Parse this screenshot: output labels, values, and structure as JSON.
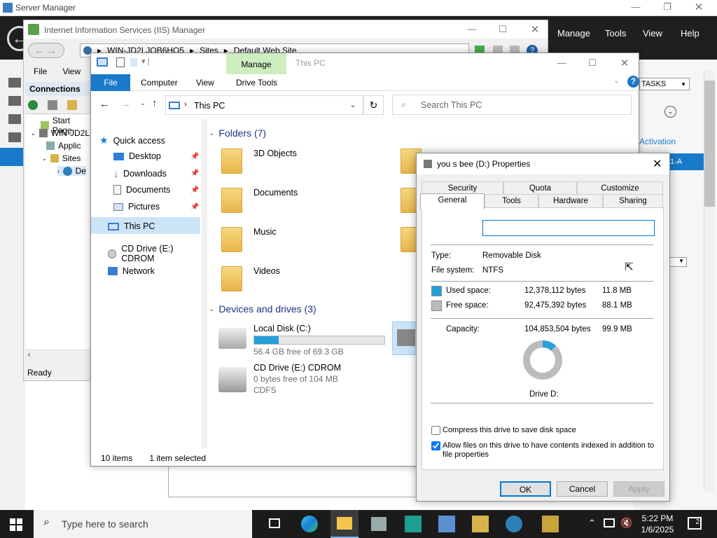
{
  "server_manager": {
    "title": "Server Manager",
    "nav": [
      "Manage",
      "Tools",
      "View",
      "Help"
    ],
    "tasks_label": "TASKS",
    "activation_link": "Activation",
    "partial_label": "1-A"
  },
  "iis": {
    "title": "Internet Information Services (IIS) Manager",
    "breadcrumb": [
      "WIN-JD2LJQB6HO5",
      "Sites",
      "Default Web Site"
    ],
    "menu": [
      "File",
      "View"
    ],
    "connections_label": "Connections",
    "tree": [
      "Start Page",
      "WIN-JD2L",
      "Applic",
      "Sites",
      "De"
    ],
    "status": "Ready"
  },
  "explorer": {
    "title": "This PC",
    "ribbon_tabs": [
      "File",
      "Computer",
      "View"
    ],
    "manage_label": "Manage",
    "drive_tools": "Drive Tools",
    "address": "This PC",
    "search_placeholder": "Search This PC",
    "nav": {
      "quick_access": "Quick access",
      "desktop": "Desktop",
      "downloads": "Downloads",
      "documents": "Documents",
      "pictures": "Pictures",
      "this_pc": "This PC",
      "cd_drive": "CD Drive (E:) CDROM",
      "network": "Network"
    },
    "folders_header": "Folders (7)",
    "folders": [
      "3D Objects",
      "Documents",
      "Music",
      "Videos"
    ],
    "devices_header": "Devices and drives (3)",
    "drives": [
      {
        "name": "Local Disk (C:)",
        "free": "56.4 GB free of 69.3 GB",
        "used_pct": 19
      },
      {
        "name": "CD Drive (E:) CDROM",
        "free": "0 bytes free of 104 MB",
        "fs": "CDFS"
      }
    ],
    "status_items": "10 items",
    "status_selected": "1 item selected"
  },
  "properties": {
    "title": "you s bee (D:) Properties",
    "tabs_row1": [
      "Security",
      "Quota",
      "Customize"
    ],
    "tabs_row2": [
      "General",
      "Tools",
      "Hardware",
      "Sharing"
    ],
    "name_value": "",
    "type_label": "Type:",
    "type_value": "Removable Disk",
    "fs_label": "File system:",
    "fs_value": "NTFS",
    "used_label": "Used space:",
    "used_bytes": "12,378,112 bytes",
    "used_mb": "11.8 MB",
    "free_label": "Free space:",
    "free_bytes": "92,475,392 bytes",
    "free_mb": "88.1 MB",
    "cap_label": "Capacity:",
    "cap_bytes": "104,853,504 bytes",
    "cap_mb": "99.9 MB",
    "used_fraction": 0.118,
    "drive_label": "Drive D:",
    "compress_label": "Compress this drive to save disk space",
    "index_label": "Allow files on this drive to have contents indexed in addition to file properties",
    "compress_checked": false,
    "index_checked": true,
    "ok": "OK",
    "cancel": "Cancel",
    "apply": "Apply",
    "used_color": "#26a0da",
    "free_color": "#bcbcbc"
  },
  "taskbar": {
    "search_placeholder": "Type here to search",
    "time": "5:22 PM",
    "date": "1/6/2025",
    "notif_count": "2"
  }
}
